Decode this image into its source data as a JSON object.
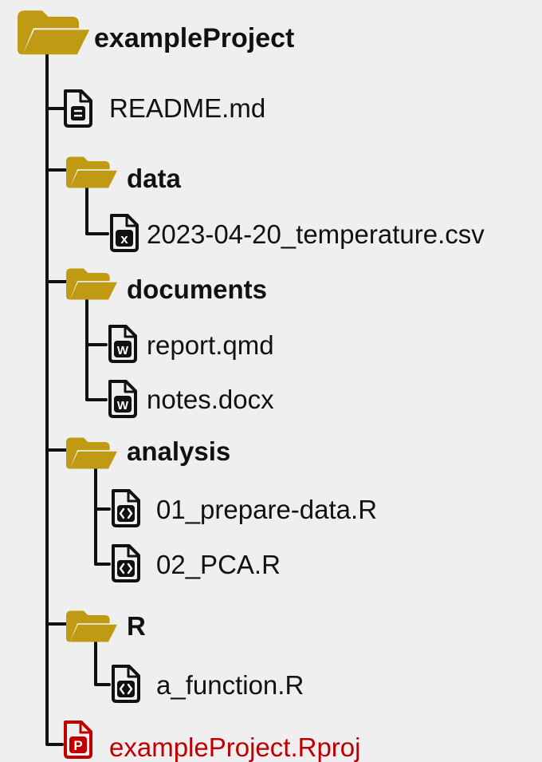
{
  "colors": {
    "folder": "#c09a12",
    "line": "#111111",
    "text": "#111111",
    "project": "#c00000",
    "background": "#efefef"
  },
  "tree": {
    "root": {
      "label": "exampleProject",
      "icon": "folder-icon"
    },
    "readme": {
      "label": "README.md",
      "icon": "text-file-icon"
    },
    "data_folder": {
      "label": "data",
      "icon": "folder-icon"
    },
    "temperature_csv": {
      "label": "2023-04-20_temperature.csv",
      "icon": "spreadsheet-file-icon"
    },
    "documents_folder": {
      "label": "documents",
      "icon": "folder-icon"
    },
    "report_qmd": {
      "label": "report.qmd",
      "icon": "word-file-icon"
    },
    "notes_docx": {
      "label": "notes.docx",
      "icon": "word-file-icon"
    },
    "analysis_folder": {
      "label": "analysis",
      "icon": "folder-icon"
    },
    "prepare_data_r": {
      "label": "01_prepare-data.R",
      "icon": "code-file-icon"
    },
    "pca_r": {
      "label": "02_PCA.R",
      "icon": "code-file-icon"
    },
    "r_folder": {
      "label": "R",
      "icon": "folder-icon"
    },
    "a_function_r": {
      "label": "a_function.R",
      "icon": "code-file-icon"
    },
    "rproj": {
      "label": "exampleProject.Rproj",
      "icon": "rproject-file-icon"
    }
  }
}
